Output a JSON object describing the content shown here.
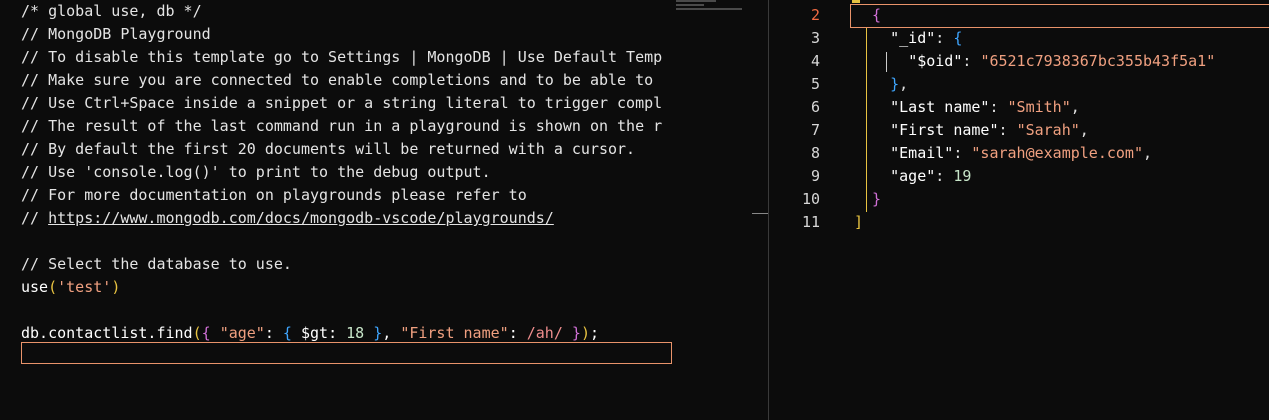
{
  "left_editor": {
    "lines": [
      "/* global use, db */",
      "// MongoDB Playground",
      "// To disable this template go to Settings | MongoDB | Use Default Temp",
      "// Make sure you are connected to enable completions and to be able to",
      "// Use Ctrl+Space inside a snippet or a string literal to trigger compl",
      "// The result of the last command run in a playground is shown on the r",
      "// By default the first 20 documents will be returned with a cursor.",
      "// Use 'console.log()' to print to the debug output.",
      "// For more documentation on playgrounds please refer to",
      "https://www.mongodb.com/docs/mongodb-vscode/playgrounds/",
      "// Select the database to use."
    ],
    "link_prefix": "// ",
    "use_stmt": {
      "fn": "use",
      "arg": "'test'"
    },
    "find_stmt": {
      "prefix": "db.contactlist.find",
      "key_age": "\"age\"",
      "op": "$gt",
      "num": "18",
      "key_name": "\"First name\"",
      "regex": "/ah/",
      "suffix": ";"
    }
  },
  "right_editor": {
    "line_numbers": [
      "2",
      "3",
      "4",
      "5",
      "6",
      "7",
      "8",
      "9",
      "10",
      "11"
    ],
    "active_line": "2",
    "result": {
      "id_key": "\"_id\"",
      "oid_key": "\"$oid\"",
      "oid_value": "\"6521c7938367bc355b43f5a1\"",
      "last_name_key": "\"Last name\"",
      "last_name_value": "\"Smith\"",
      "first_name_key": "\"First name\"",
      "first_name_value": "\"Sarah\"",
      "email_key": "\"Email\"",
      "email_value": "\"sarah@example.com\"",
      "age_key": "\"age\"",
      "age_value": "19"
    }
  },
  "colors": {
    "accent_active": "#e9936a",
    "bracket_1": "#e8c341",
    "bracket_2": "#d070d6",
    "bracket_3": "#3fa6ff",
    "string": "#f0a080"
  }
}
